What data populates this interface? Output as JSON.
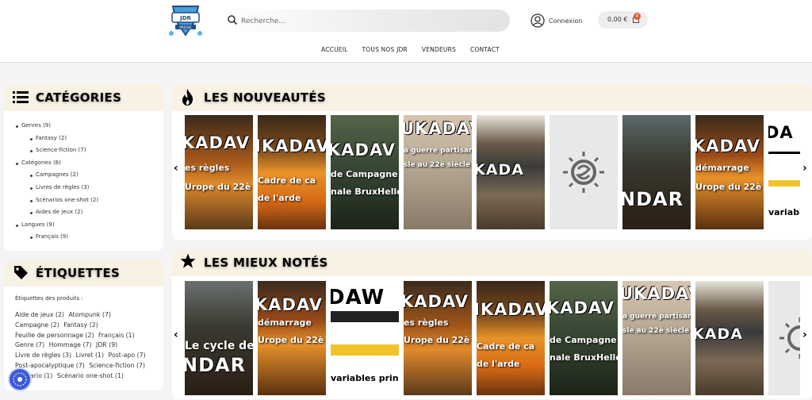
{
  "header": {
    "logo_text": "JDR PRESSE",
    "search_placeholder": "Recherche...",
    "login_label": "Connexion",
    "cart_amount": "0,00 €",
    "cart_count": "0"
  },
  "nav": [
    "ACCUEIL",
    "TOUS NOS JDR",
    "VENDEURS",
    "CONTACT"
  ],
  "categories": {
    "title": "CATÉGORIES",
    "items": [
      {
        "label": "Genres (9)",
        "level": 0
      },
      {
        "label": "Fantasy (2)",
        "level": 1
      },
      {
        "label": "Science-fiction (7)",
        "level": 1
      },
      {
        "label": "Catégories (8)",
        "level": 0
      },
      {
        "label": "Campagnes (2)",
        "level": 1
      },
      {
        "label": "Livres de règles (3)",
        "level": 1
      },
      {
        "label": "Scénarios one-shot (2)",
        "level": 1
      },
      {
        "label": "Aides de jeux (2)",
        "level": 1
      },
      {
        "label": "Langues (9)",
        "level": 0
      },
      {
        "label": "Français (9)",
        "level": 1
      }
    ]
  },
  "tags": {
    "title": "ÉTIQUETTES",
    "label": "Étiquettes des produits :",
    "items": [
      "Aide de jeux (2)",
      "Atompunk (7)",
      "Campagne (2)",
      "Fantasy (2)",
      "Feuille de personnage (2)",
      "Français (1)",
      "Genre (7)",
      "Hommage (7)",
      "JDR (9)",
      "Livre de règles (3)",
      "Livret (1)",
      "Post-apo (7)",
      "Post-apocalyptique (7)",
      "Science-fiction (7)",
      "Scénario (1)",
      "Scénario one-shot (1)"
    ]
  },
  "sections": {
    "new": {
      "title": "LES NOUVEAUTÉS"
    },
    "top": {
      "title": "LES MIEUX NOTÉS"
    }
  },
  "colors": {
    "accent": "#e05a2a",
    "section_header": "#f7f2e3"
  }
}
